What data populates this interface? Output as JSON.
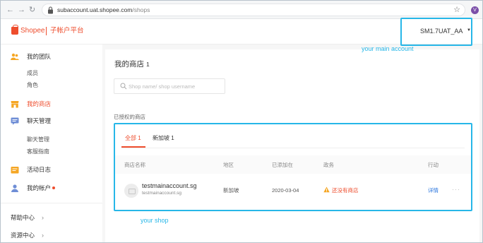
{
  "browser": {
    "back_icon": "back-arrow-icon",
    "forward_icon": "forward-arrow-icon",
    "reload_icon": "reload-icon",
    "url_domain": "subaccount.uat.shopee.com",
    "url_path": "/shops",
    "bookmark_icon": "star-icon",
    "profile_initial": "V"
  },
  "header": {
    "logo_text": "Shopee",
    "platform_title": "子帐户平台",
    "account_name": "SM1.7UAT_AA"
  },
  "sidebar": {
    "groups": [
      {
        "label": "我的团队",
        "icon": "team-icon",
        "subitems": [
          "成员",
          "角色"
        ]
      },
      {
        "label": "我的商店",
        "icon": "shop-icon",
        "subitems": []
      },
      {
        "label": "聊天管理",
        "icon": "chat-icon",
        "subitems": [
          "聊天管理",
          "客服指南"
        ]
      },
      {
        "label": "活动日志",
        "icon": "log-icon",
        "subitems": []
      },
      {
        "label": "我的帐户",
        "icon": "account-icon",
        "subitems": []
      }
    ],
    "footer": [
      "帮助中心",
      "资源中心"
    ]
  },
  "main": {
    "title": "我的商店",
    "title_count": "1",
    "search_placeholder": "Shop name/ shop username",
    "authorized_label": "已授权的商店",
    "tabs": [
      {
        "label": "全部",
        "count": "1"
      },
      {
        "label": "新加坡",
        "count": "1"
      }
    ],
    "columns": [
      "商店名称",
      "地区",
      "已添加在",
      "政务",
      "行动"
    ],
    "rows": [
      {
        "shop_name": "testmainaccount.sg",
        "shop_username": "testmainaccount.sg",
        "region": "新加坡",
        "added_on": "2020-03-04",
        "status": "还没有商店",
        "action": "详情",
        "more": "···"
      }
    ]
  },
  "annotations": {
    "main_account": "your main account",
    "shop": "your shop"
  },
  "colors": {
    "brand": "#ee4d2d",
    "annotation": "#27b7e8",
    "link": "#2673dd"
  }
}
